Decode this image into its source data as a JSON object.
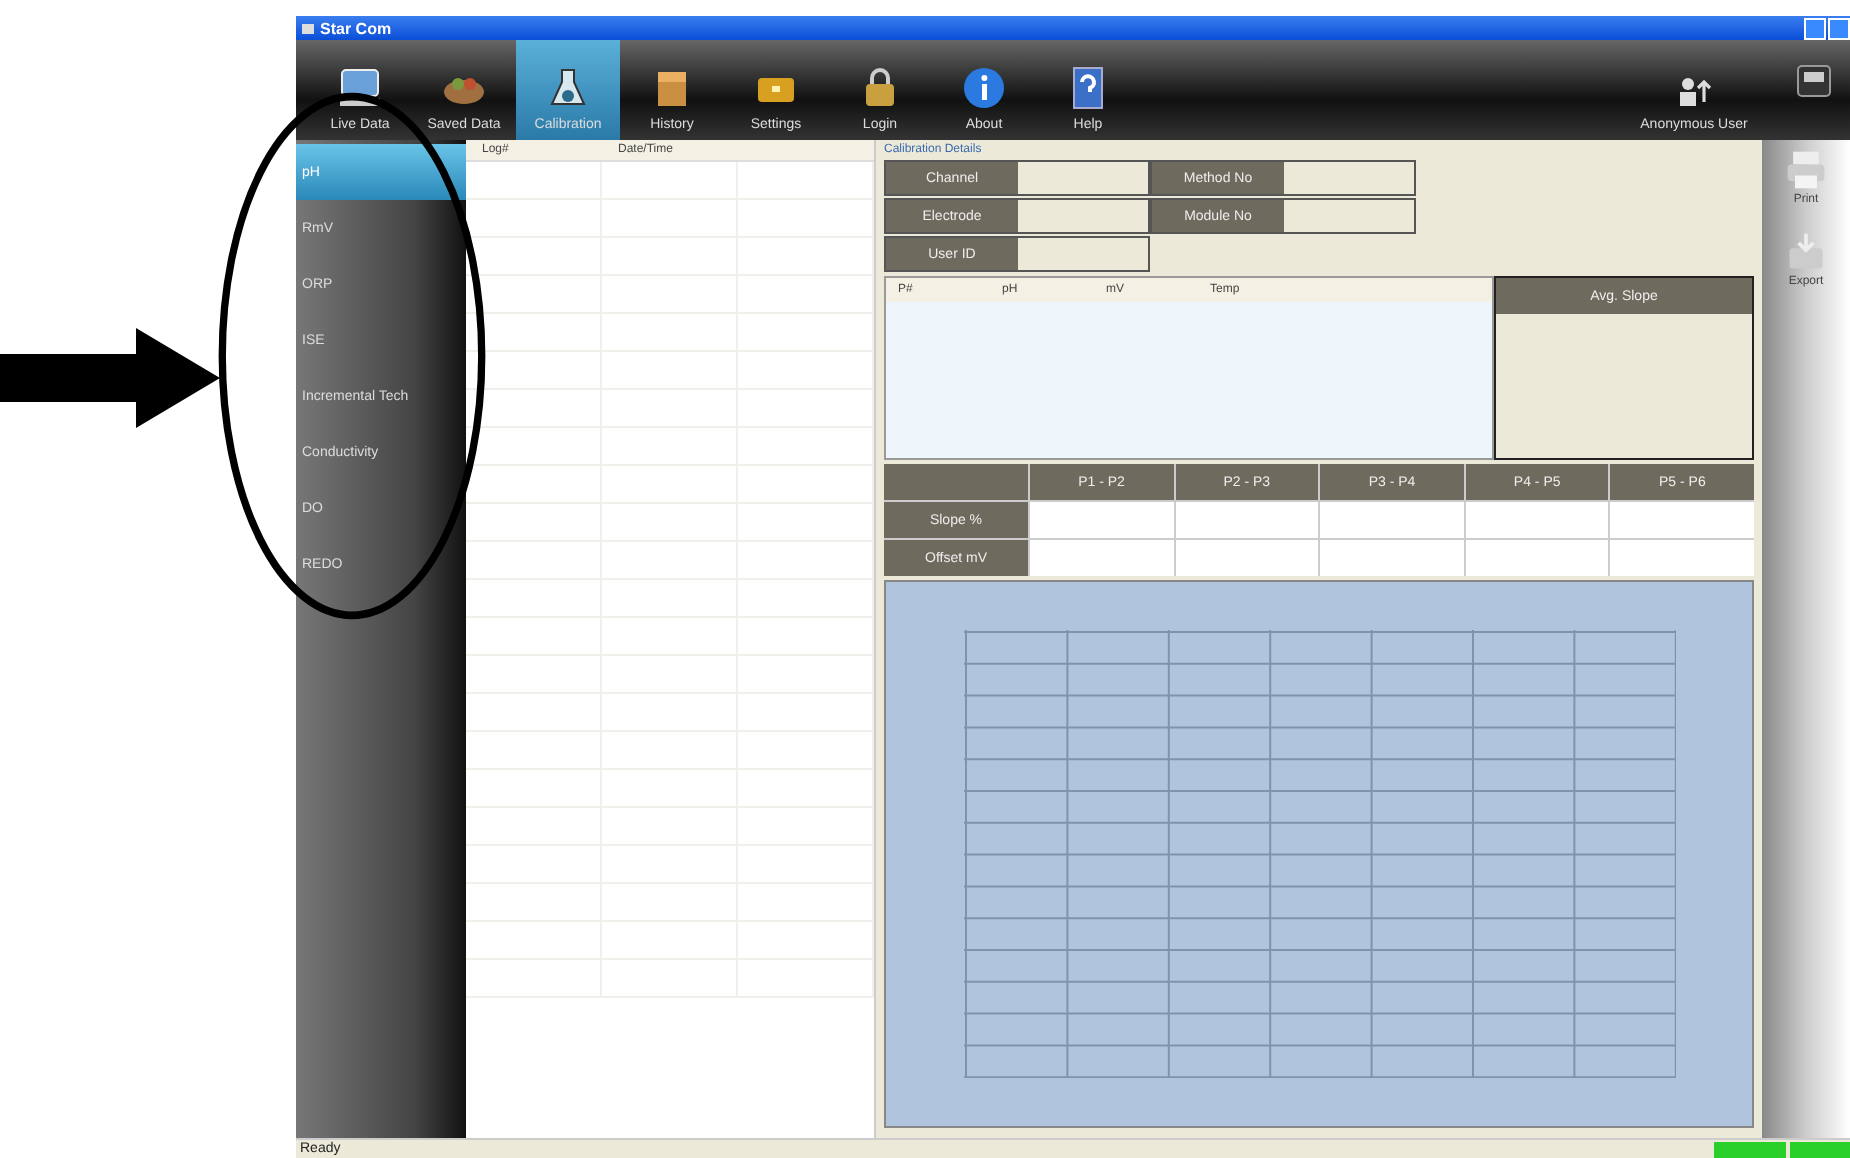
{
  "window": {
    "title": "Star Com"
  },
  "toolbar": {
    "items": [
      {
        "label": "Live Data",
        "selected": false
      },
      {
        "label": "Saved Data",
        "selected": false
      },
      {
        "label": "Calibration",
        "selected": true
      },
      {
        "label": "History",
        "selected": false
      },
      {
        "label": "Settings",
        "selected": false
      },
      {
        "label": "Login",
        "selected": false
      },
      {
        "label": "About",
        "selected": false
      },
      {
        "label": "Help",
        "selected": false
      }
    ],
    "user": "Anonymous User"
  },
  "sidebar": {
    "items": [
      {
        "label": "pH",
        "selected": true
      },
      {
        "label": "RmV",
        "selected": false
      },
      {
        "label": "ORP",
        "selected": false
      },
      {
        "label": "ISE",
        "selected": false
      },
      {
        "label": "Incremental Tech",
        "selected": false
      },
      {
        "label": "Conductivity",
        "selected": false
      },
      {
        "label": "DO",
        "selected": false
      },
      {
        "label": "REDO",
        "selected": false
      }
    ]
  },
  "log_table": {
    "columns": [
      "Log#",
      "Date/Time"
    ]
  },
  "calibration": {
    "title": "Calibration Details",
    "fields": [
      {
        "label": "Channel"
      },
      {
        "label": "Method No"
      },
      {
        "label": "Electrode"
      },
      {
        "label": "Module No"
      },
      {
        "label": "User ID"
      }
    ],
    "points_table": {
      "columns": [
        "P#",
        "pH",
        "mV",
        "Temp"
      ]
    },
    "avg_slope": "Avg. Slope",
    "slope_table": {
      "columns": [
        "P1 - P2",
        "P2 - P3",
        "P3 - P4",
        "P4 - P5",
        "P5 - P6"
      ],
      "rows": [
        "Slope %",
        "Offset mV"
      ]
    }
  },
  "side_actions": [
    "Print",
    "Export"
  ],
  "status_bar": {
    "text": "Ready"
  }
}
